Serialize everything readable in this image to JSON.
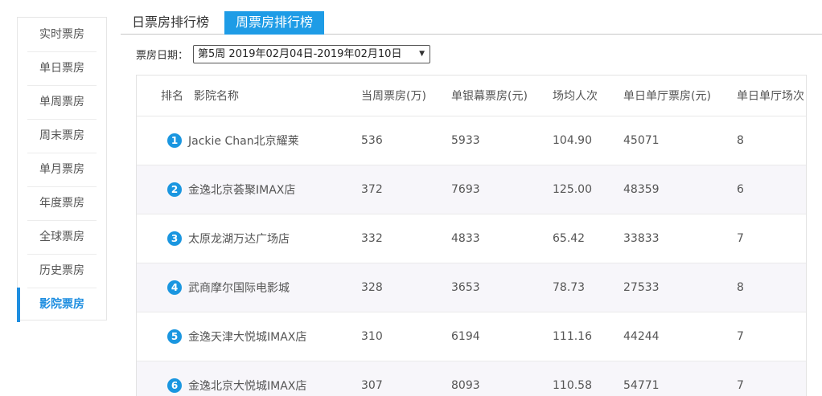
{
  "sidebar": {
    "items": [
      {
        "label": "实时票房"
      },
      {
        "label": "单日票房"
      },
      {
        "label": "单周票房"
      },
      {
        "label": "周末票房"
      },
      {
        "label": "单月票房"
      },
      {
        "label": "年度票房"
      },
      {
        "label": "全球票房"
      },
      {
        "label": "历史票房"
      },
      {
        "label": "影院票房",
        "active": true
      }
    ]
  },
  "tabs": [
    {
      "label": "日票房排行榜"
    },
    {
      "label": "周票房排行榜",
      "active": true
    }
  ],
  "filter": {
    "label": "票房日期：",
    "selected": "第5周 2019年02月04日-2019年02月10日"
  },
  "table": {
    "headers": {
      "rank": "排名",
      "name": "影院名称",
      "weekly": "当周票房(万)",
      "screen": "单银幕票房(元)",
      "avg": "场均人次",
      "hall": "单日单厅票房(元)",
      "shows": "单日单厅场次"
    },
    "rows": [
      {
        "rank": "1",
        "name": "Jackie Chan北京耀莱",
        "weekly": "536",
        "screen": "5933",
        "avg": "104.90",
        "hall": "45071",
        "shows": "8"
      },
      {
        "rank": "2",
        "name": "金逸北京荟聚IMAX店",
        "weekly": "372",
        "screen": "7693",
        "avg": "125.00",
        "hall": "48359",
        "shows": "6"
      },
      {
        "rank": "3",
        "name": "太原龙湖万达广场店",
        "weekly": "332",
        "screen": "4833",
        "avg": "65.42",
        "hall": "33833",
        "shows": "7"
      },
      {
        "rank": "4",
        "name": "武商摩尔国际电影城",
        "weekly": "328",
        "screen": "3653",
        "avg": "78.73",
        "hall": "27533",
        "shows": "8"
      },
      {
        "rank": "5",
        "name": "金逸天津大悦城IMAX店",
        "weekly": "310",
        "screen": "6194",
        "avg": "111.16",
        "hall": "44244",
        "shows": "7"
      },
      {
        "rank": "6",
        "name": "金逸北京大悦城IMAX店",
        "weekly": "307",
        "screen": "8093",
        "avg": "110.58",
        "hall": "54771",
        "shows": "7"
      }
    ]
  },
  "colors": {
    "accent": "#1e9ce6",
    "row_alt": "#f7f6fa"
  }
}
